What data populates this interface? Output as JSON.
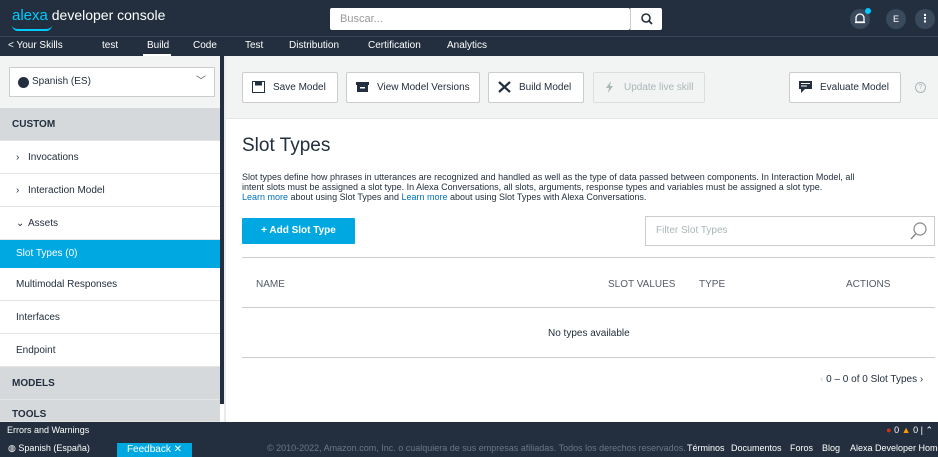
{
  "header": {
    "brand_alexa": "alexa",
    "brand_rest": "developer console",
    "search_placeholder": "Buscar...",
    "avatar_initial": "E"
  },
  "nav": {
    "back": "< Your Skills",
    "skill_name": "test",
    "tabs": [
      "Build",
      "Code",
      "Test",
      "Distribution",
      "Certification",
      "Analytics"
    ],
    "active_tab": "Build"
  },
  "sidebar": {
    "language": "Spanish (ES)",
    "section_custom": "CUSTOM",
    "items": [
      "Invocations",
      "Interaction Model",
      "Assets"
    ],
    "sub_items": [
      "Slot Types (0)",
      "Multimodal Responses",
      "Interfaces",
      "Endpoint"
    ],
    "active_item": "Slot Types (0)",
    "section_models": "MODELS",
    "section_tools": "TOOLS"
  },
  "toolbar": {
    "save": "Save Model",
    "versions": "View Model Versions",
    "build": "Build Model",
    "update": "Update live skill",
    "evaluate": "Evaluate Model"
  },
  "main": {
    "title": "Slot Types",
    "desc_line1": "Slot types define how phrases in utterances are recognized and handled as well as the type of data passed between components. In Interaction Model, all",
    "desc_line2": "intent slots must be assigned a slot type. In Alexa Conversations, all slots, arguments, response types and variables must be assigned a slot type.",
    "learn_more": "Learn more",
    "desc_line3a": " about using Slot Types and ",
    "desc_line3b": " about using Slot Types with Alexa Conversations.",
    "add_button": "+ Add Slot Type",
    "filter_placeholder": "Filter Slot Types",
    "columns": [
      "NAME",
      "SLOT VALUES",
      "TYPE",
      "ACTIONS"
    ],
    "empty": "No types available",
    "pager": "0 – 0 of 0 Slot Types"
  },
  "bottom": {
    "errors_label": "Errors and Warnings",
    "error_count": "0",
    "warning_count": "0",
    "language": "Spanish (España)",
    "feedback": "Feedback",
    "copyright": "© 2010-2022, Amazon.com, Inc. o cualquiera de sus empresas afiliadas. Todos los derechos reservados.",
    "links": [
      "Términos",
      "Documentos",
      "Foros",
      "Blog",
      "Alexa Developer Home"
    ]
  },
  "colors": {
    "header_bg": "#232f3e",
    "accent": "#00a8e1",
    "brand_blue": "#00caff",
    "link": "#0073bb"
  }
}
